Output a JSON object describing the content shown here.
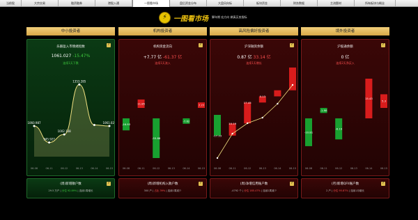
{
  "tabs": [
    "当前股",
    "大宗交易",
    "融资融券",
    "港股入通",
    "一图看市场",
    "盘后资金分布",
    "大盘风向标",
    "板块资金",
    "财务数据",
    "主流题材",
    "所有板块与概念"
  ],
  "active_tab": 4,
  "brand": {
    "title": "一图看市场",
    "slogan": "脚年期 宏方向 做真买卖指标"
  },
  "colors": {
    "green": "#3ecb3e",
    "red": "#ff5050",
    "gold": "#d8a848"
  },
  "panels": [
    {
      "header": "中小投资者",
      "theme": "green",
      "title": "乐跟盈入市情绪指数",
      "value": "1061.027",
      "change": "-15.47%",
      "sub": "连续1天下跌",
      "chart_data": {
        "type": "area",
        "categories": [
          "06-08",
          "06-11",
          "06-12",
          "06-13",
          "06-14",
          "06-15"
        ],
        "values": [
          1060.987,
          945.927,
          1002.138,
          1353.285,
          1068.5,
          1061.027
        ],
        "labels": [
          "1060.987",
          "945.927",
          "1002.138",
          "1353.285",
          "",
          "1061.027"
        ]
      },
      "foot_title": "(周)新增散户数",
      "foot_value": "29.5 万户",
      "foot_change": "分位 92.89%",
      "foot_trend": "连续1周增长"
    },
    {
      "header": "机构投资者",
      "theme": "red",
      "title": "机构资金流向",
      "value": "+7.77 亿",
      "change": "-61.37 亿",
      "sub": "连续1天流入",
      "chart_data": {
        "type": "bar",
        "categories": [
          "06-08",
          "06-11",
          "06-12",
          "06-13",
          "06-14",
          "06-15"
        ],
        "values": [
          -16.93,
          11.85,
          -55.88,
          0,
          -7.62,
          7.77
        ],
        "labels": [
          "-16.93",
          "11.85",
          "-55.88",
          "",
          "-7.62",
          "7.77"
        ]
      },
      "foot_title": "(周)新增机构入散户数",
      "foot_value": "300 户",
      "foot_change": "占比 39%",
      "foot_trend": "连续1周减少"
    },
    {
      "header": "高风险偏好投资者",
      "theme": "red",
      "title": "沪深融资余额",
      "value": "0.87 亿",
      "change": "33.14 亿",
      "sub": "连续1天增长",
      "chart_data": {
        "type": "bar",
        "categories": [
          "06-08",
          "06-11",
          "06-12",
          "06-13",
          "06-14",
          "06-15"
        ],
        "values": [
          -17.33,
          10.19,
          17.45,
          5.13,
          5.1,
          33.14
        ],
        "labels": [
          "-17.33",
          "10.19",
          "17.45",
          "5.13",
          "",
          "33.14"
        ]
      },
      "foot_title": "(周)净增信用账户数",
      "foot_value": "-4792 个",
      "foot_change": "分位 185.47%",
      "foot_trend": "连续2周减少"
    },
    {
      "header": "境外投资者",
      "theme": "red",
      "title": "沪股通余额",
      "value": "0 亿",
      "change": "",
      "sub": "连续2天净买入",
      "chart_data": {
        "type": "bar",
        "categories": [
          "06-08",
          "06-11",
          "06-12",
          "06-13",
          "06-14",
          "06-15"
        ],
        "values": [
          -10.81,
          -1.98,
          -8.19,
          0,
          15.43,
          5.3
        ],
        "labels": [
          "-10.81",
          "-1.98",
          "-8.19",
          "",
          "15.43",
          "5.3"
        ]
      },
      "foot_title": "(月)新增QFII账户数",
      "foot_value": "2 户",
      "foot_change": "分位 95.87%",
      "foot_trend": "连续1月增长"
    }
  ]
}
